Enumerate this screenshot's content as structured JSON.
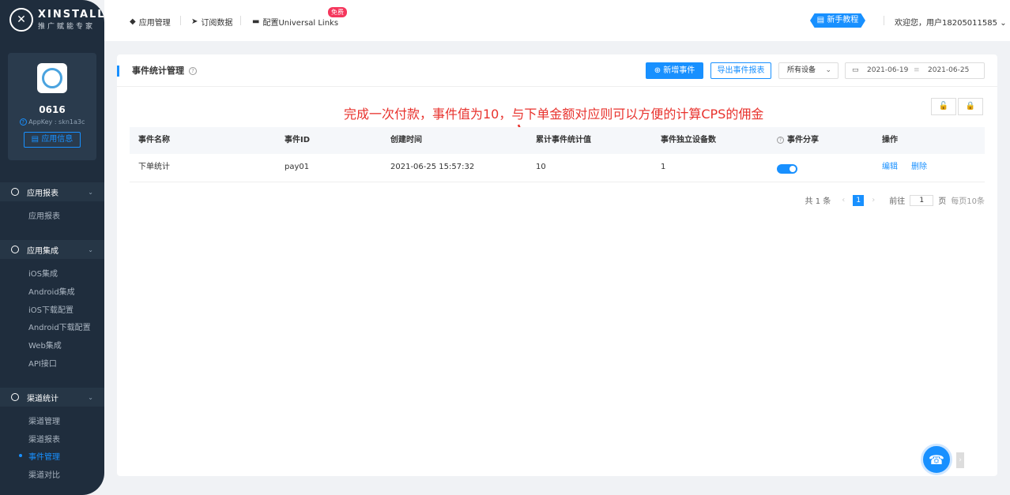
{
  "brand": {
    "name": "XINSTALL",
    "tagline": "推广赋能专家"
  },
  "app": {
    "name": "0616",
    "appkey": "AppKey : skn1a3c",
    "info_button": "应用信息"
  },
  "sidebar": {
    "groups": [
      {
        "label": "应用报表",
        "items": [
          "应用报表"
        ]
      },
      {
        "label": "应用集成",
        "items": [
          "iOS集成",
          "Android集成",
          "iOS下载配置",
          "Android下载配置",
          "Web集成",
          "API接口"
        ]
      },
      {
        "label": "渠道统计",
        "items": [
          "渠道管理",
          "渠道报表",
          "事件管理",
          "渠道对比"
        ]
      }
    ]
  },
  "topnav": {
    "app_manage": "应用管理",
    "subscribe": "订阅数据",
    "universal_links": "配置Universal Links",
    "free_badge": "免费",
    "tutorial": "新手教程",
    "welcome": "欢迎您，用户18205011585"
  },
  "panel": {
    "title": "事件统计管理",
    "add_event": "新增事件",
    "export_report": "导出事件报表",
    "device_select": "所有设备",
    "date_start": "2021-06-19",
    "date_end": "2021-06-25",
    "annotation": "完成一次付款，事件值为10，与下单金额对应则可以方便的计算CPS的佣金"
  },
  "table": {
    "headers": [
      "事件名称",
      "事件ID",
      "创建时间",
      "累计事件统计值",
      "事件独立设备数",
      "事件分享",
      "操作"
    ],
    "rows": [
      {
        "name": "下单统计",
        "id": "pay01",
        "created": "2021-06-25 15:57:32",
        "total": "10",
        "devices": "1",
        "shared": true,
        "edit": "编辑",
        "delete": "删除"
      }
    ]
  },
  "pager": {
    "total": "共 1 条",
    "current": "1",
    "goto_label": "前往",
    "goto_value": "1",
    "page_unit": "页",
    "per_page": "每页10条"
  },
  "colors": {
    "accent": "#1890ff",
    "sidebar": "#1f2d3d",
    "annotation": "#e8322d"
  }
}
